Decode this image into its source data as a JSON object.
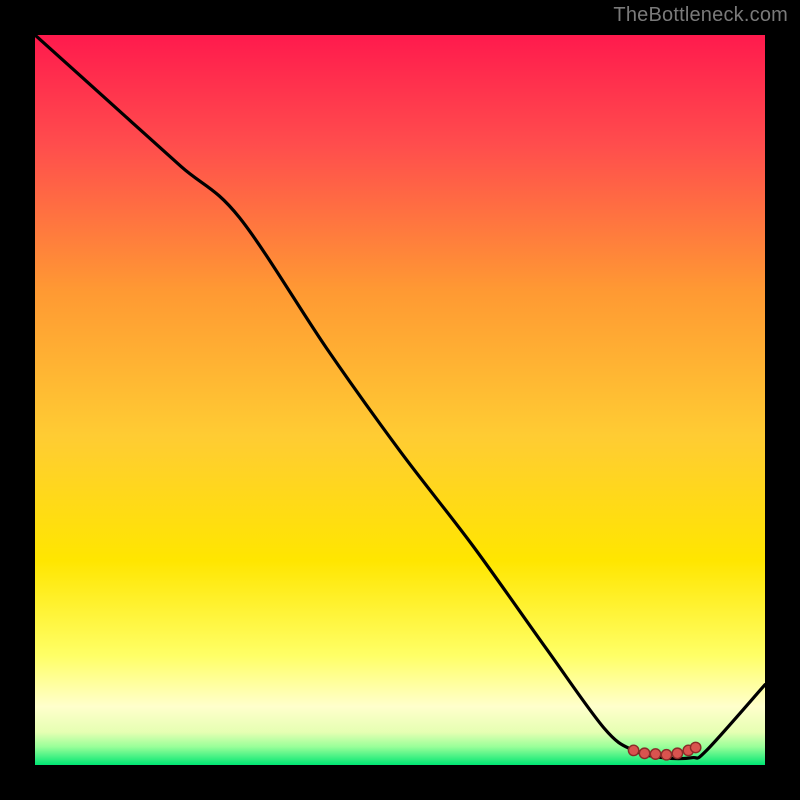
{
  "attribution": "TheBottleneck.com",
  "colors": {
    "bg": "#000000",
    "grad_top": "#ff1a4d",
    "grad_mid1": "#ff9933",
    "grad_mid2": "#ffe600",
    "grad_mid3": "#ffff99",
    "grad_bottom": "#00e673",
    "curve": "#000000",
    "dot_fill": "#d9534f",
    "dot_stroke": "#8a2b28"
  },
  "chart_data": {
    "type": "line",
    "title": "",
    "xlabel": "",
    "ylabel": "",
    "xlim": [
      0,
      100
    ],
    "ylim": [
      0,
      100
    ],
    "series": [
      {
        "name": "curve",
        "x": [
          0,
          10,
          20,
          28,
          40,
          50,
          60,
          70,
          78,
          82,
          86,
          90,
          92,
          100
        ],
        "y": [
          100,
          91,
          82,
          75,
          57,
          43,
          30,
          16,
          5,
          2,
          1,
          1,
          2,
          11
        ]
      }
    ],
    "markers": {
      "name": "highlight-range",
      "points": [
        {
          "x": 82,
          "y": 2.0
        },
        {
          "x": 83.5,
          "y": 1.6
        },
        {
          "x": 85,
          "y": 1.5
        },
        {
          "x": 86.5,
          "y": 1.4
        },
        {
          "x": 88,
          "y": 1.6
        },
        {
          "x": 89.5,
          "y": 2.0
        },
        {
          "x": 90.5,
          "y": 2.4
        }
      ]
    }
  }
}
